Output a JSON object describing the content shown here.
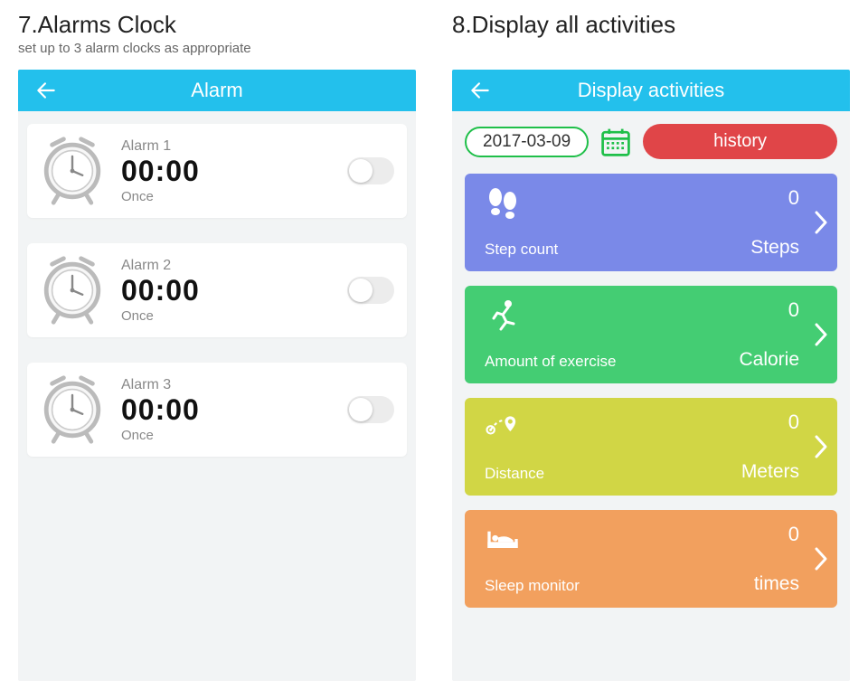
{
  "left": {
    "heading": "7.Alarms Clock",
    "subheading": "set up to 3 alarm clocks as appropriate",
    "screen_title": "Alarm",
    "alarms": [
      {
        "name": "Alarm 1",
        "time": "00:00",
        "repeat": "Once"
      },
      {
        "name": "Alarm 2",
        "time": "00:00",
        "repeat": "Once"
      },
      {
        "name": "Alarm 3",
        "time": "00:00",
        "repeat": "Once"
      }
    ]
  },
  "right": {
    "heading": "8.Display all activities",
    "screen_title": "Display activities",
    "date": "2017-03-09",
    "history_label": "history",
    "cards": [
      {
        "label": "Step count",
        "value": "0",
        "unit": "Steps"
      },
      {
        "label": "Amount of exercise",
        "value": "0",
        "unit": "Calorie"
      },
      {
        "label": "Distance",
        "value": "0",
        "unit": "Meters"
      },
      {
        "label": "Sleep monitor",
        "value": "0",
        "unit": "times"
      }
    ]
  }
}
